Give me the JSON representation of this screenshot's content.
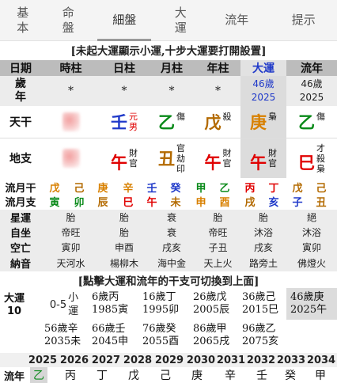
{
  "tabs": [
    {
      "line1": "基",
      "line2": "本"
    },
    {
      "line1": "命",
      "line2": "盤"
    },
    {
      "line1": "細盤",
      "line2": ""
    },
    {
      "line1": "大",
      "line2": "運"
    },
    {
      "line1": "流年",
      "line2": ""
    },
    {
      "line1": "提示",
      "line2": ""
    }
  ],
  "banner_top": "[未起大運顯示小運,十步大運要打開設置]",
  "banner_mid": "[點擊大運和流年的干支可切換到上面]",
  "header": {
    "date": "日期",
    "hour": "時柱",
    "day": "日柱",
    "month": "月柱",
    "year": "年柱",
    "dayun": "大運",
    "liunian": "流年"
  },
  "age_row": {
    "label1": "歲",
    "label2": "年",
    "hour": "*",
    "day": "*",
    "month": "*",
    "year": "*",
    "dayun_age": "46歲",
    "dayun_year": "2025",
    "liunian_age": "46歲",
    "liunian_year": "2025"
  },
  "tiangan": {
    "label": "天干",
    "day_char": "壬",
    "day_note1": "元",
    "day_note2": "男",
    "month_char": "乙",
    "month_note": "傷",
    "year_char": "戊",
    "year_note": "殺",
    "dayun_char": "庚",
    "dayun_note": "梟",
    "liunian_char": "乙",
    "liunian_note": "傷"
  },
  "dizhi": {
    "label": "地支",
    "day_char": "午",
    "day_hidden": [
      "財",
      "官"
    ],
    "month_char": "丑",
    "month_hidden": [
      "官",
      "劫",
      "印"
    ],
    "year_char": "午",
    "year_hidden": [
      "財",
      "官"
    ],
    "dayun_char": "午",
    "dayun_hidden": [
      "財",
      "官"
    ],
    "liunian_char": "巳",
    "liunian_hidden": [
      "才",
      "殺",
      "梟"
    ]
  },
  "liuyue_gan": {
    "label": "流月干",
    "items": [
      "戊",
      "己",
      "庚",
      "辛",
      "壬",
      "癸",
      "甲",
      "乙",
      "丙",
      "丁",
      "戊",
      "己"
    ]
  },
  "liuyue_zhi": {
    "label": "流月支",
    "items": [
      "寅",
      "卯",
      "辰",
      "巳",
      "午",
      "未",
      "申",
      "酉",
      "戌",
      "亥",
      "子",
      "丑"
    ]
  },
  "xingyun": {
    "label": "星運",
    "hour": "胎",
    "day": "胎",
    "month": "衰",
    "year": "胎",
    "dayun": "胎",
    "liunian": "絕"
  },
  "zizuo": {
    "label": "自坐",
    "hour": "帝旺",
    "day": "胎",
    "month": "衰",
    "year": "帝旺",
    "dayun": "沐浴",
    "liunian": "沐浴"
  },
  "kongwang": {
    "label": "空亡",
    "hour": "寅卯",
    "day": "申酉",
    "month": "戌亥",
    "year": "子丑",
    "dayun": "戌亥",
    "liunian": "寅卯"
  },
  "nayin": {
    "label": "納音",
    "hour": "天河水",
    "day": "楊柳木",
    "month": "海中金",
    "year": "天上火",
    "dayun": "路旁土",
    "liunian": "佛燈火"
  },
  "dayun_list": {
    "label": "大運",
    "start": "10",
    "xiaoyun_age": "0-5",
    "xiaoyun_text1": "小",
    "xiaoyun_text2": "運",
    "items": [
      {
        "age": "6歲",
        "gz1": "丙",
        "year": "1985",
        "gz2": "寅"
      },
      {
        "age": "16歲",
        "gz1": "丁",
        "year": "1995",
        "gz2": "卯"
      },
      {
        "age": "26歲",
        "gz1": "戊",
        "year": "2005",
        "gz2": "辰"
      },
      {
        "age": "36歲",
        "gz1": "己",
        "year": "2015",
        "gz2": "巳"
      },
      {
        "age": "46歲",
        "gz1": "庚",
        "year": "2025",
        "gz2": "午"
      },
      {
        "age": "56歲",
        "gz1": "辛",
        "year": "2035",
        "gz2": "未"
      },
      {
        "age": "66歲",
        "gz1": "壬",
        "year": "2045",
        "gz2": "申"
      },
      {
        "age": "76歲",
        "gz1": "癸",
        "year": "2055",
        "gz2": "酉"
      },
      {
        "age": "86歲",
        "gz1": "甲",
        "year": "2065",
        "gz2": "戌"
      },
      {
        "age": "96歲",
        "gz1": "乙",
        "year": "2075",
        "gz2": "亥"
      }
    ]
  },
  "years": [
    "2025",
    "2026",
    "2027",
    "2028",
    "2029",
    "2030",
    "2031",
    "2032",
    "2033",
    "2034"
  ],
  "liunian_row": {
    "label": "流年",
    "items": [
      "乙",
      "丙",
      "丁",
      "戊",
      "己",
      "庚",
      "辛",
      "壬",
      "癸",
      "甲"
    ]
  },
  "colors": {
    "wood": "#0a8a1a",
    "fire": "#e00000",
    "earth": "#b36a00",
    "metal": "#d88000",
    "water": "#1f39c9"
  }
}
